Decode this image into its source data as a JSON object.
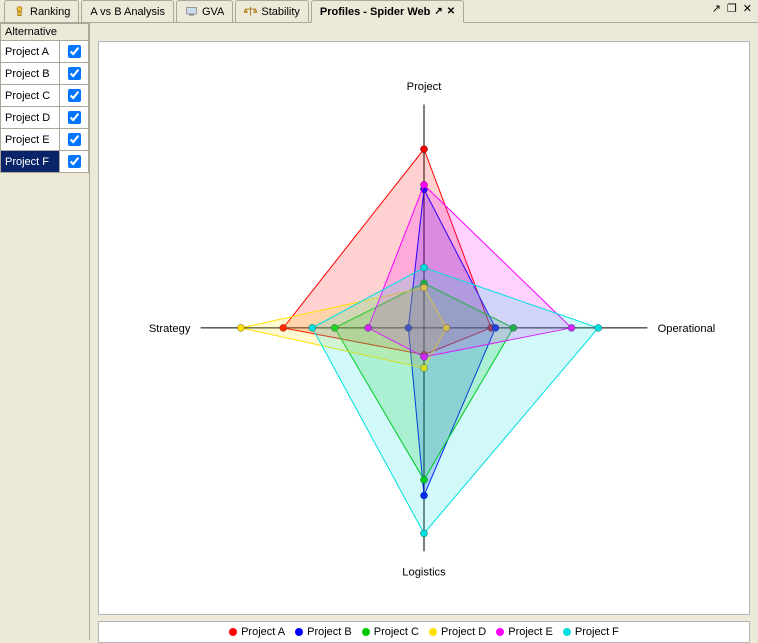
{
  "tabs": {
    "ranking": "Ranking",
    "avb": "A vs B Analysis",
    "gva": "GVA",
    "stability": "Stability",
    "active": "Profiles - Spider Web"
  },
  "window_controls": {
    "detach": "↗",
    "min": "❐",
    "close": "✕"
  },
  "sidebar": {
    "header": "Alternative",
    "items": [
      {
        "label": "Project A",
        "checked": true,
        "selected": false
      },
      {
        "label": "Project B",
        "checked": true,
        "selected": false
      },
      {
        "label": "Project C",
        "checked": true,
        "selected": false
      },
      {
        "label": "Project D",
        "checked": true,
        "selected": false
      },
      {
        "label": "Project E",
        "checked": true,
        "selected": false
      },
      {
        "label": "Project F",
        "checked": true,
        "selected": true
      }
    ]
  },
  "chart_data": {
    "type": "radar",
    "axes": [
      "Project",
      "Operational",
      "Logistics",
      "Strategy"
    ],
    "range": [
      0,
      1
    ],
    "series": [
      {
        "name": "Project A",
        "color": "#ff0000",
        "values": {
          "Project": 0.8,
          "Operational": 0.3,
          "Logistics": 0.12,
          "Strategy": 0.63
        }
      },
      {
        "name": "Project B",
        "color": "#0000ff",
        "values": {
          "Project": 0.62,
          "Operational": 0.32,
          "Logistics": 0.75,
          "Strategy": 0.07
        }
      },
      {
        "name": "Project C",
        "color": "#00c800",
        "values": {
          "Project": 0.2,
          "Operational": 0.4,
          "Logistics": 0.68,
          "Strategy": 0.4
        }
      },
      {
        "name": "Project D",
        "color": "#ffe000",
        "values": {
          "Project": 0.18,
          "Operational": 0.1,
          "Logistics": 0.18,
          "Strategy": 0.82
        }
      },
      {
        "name": "Project E",
        "color": "#ff00ff",
        "values": {
          "Project": 0.64,
          "Operational": 0.66,
          "Logistics": 0.13,
          "Strategy": 0.25
        }
      },
      {
        "name": "Project F",
        "color": "#00e0e0",
        "values": {
          "Project": 0.27,
          "Operational": 0.78,
          "Logistics": 0.92,
          "Strategy": 0.5
        }
      }
    ],
    "labels": {
      "top": "Project",
      "right": "Operational",
      "bottom": "Logistics",
      "left": "Strategy"
    }
  },
  "legend_prefix": ""
}
